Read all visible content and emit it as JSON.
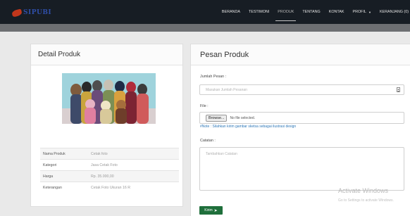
{
  "brand": {
    "name": "SIPUBI"
  },
  "nav": {
    "items": [
      {
        "label": "BERANDA"
      },
      {
        "label": "TESTIMONI"
      },
      {
        "label": "PRODUK"
      },
      {
        "label": "TENTANG"
      },
      {
        "label": "KONTAK"
      },
      {
        "label": "PROFIL",
        "caret": "▼"
      },
      {
        "label": "KERANJANG (0)"
      }
    ],
    "active": "PRODUK"
  },
  "detail": {
    "title": "Detail Produk",
    "photo_icon": "group-photo-image",
    "rows": [
      {
        "key": "Nama Produk",
        "value": "Cetak foto"
      },
      {
        "key": "Kategori",
        "value": "Jasa Cetak Foto"
      },
      {
        "key": "Harga",
        "value": "Rp. 35.000,00"
      },
      {
        "key": "Keterangan",
        "value": "Cetak Foto Ukuran 16 R"
      }
    ]
  },
  "order": {
    "title": "Pesan Produk",
    "qty_label": "Jumlah Pesan :",
    "qty_placeholder": "Masukan Jumlah Pesanan",
    "file_label": "File :",
    "browse_label": "Browse...",
    "no_file_text": "No file selected.",
    "note": "#Note : Silahkan kirim gambar sketsa sebagai ilustrasi design",
    "notes_label": "Catatan :",
    "notes_placeholder": "Tambahkan Catatan",
    "submit_label": "Kirim"
  },
  "os_watermark": {
    "title": "Activate Windows",
    "subtitle": "Go to Settings to activate Windows."
  },
  "colors": {
    "navbar": "#171d24",
    "banner": "#6d6f72",
    "submit": "#1f6f3b",
    "note_link": "#2e78b8"
  }
}
